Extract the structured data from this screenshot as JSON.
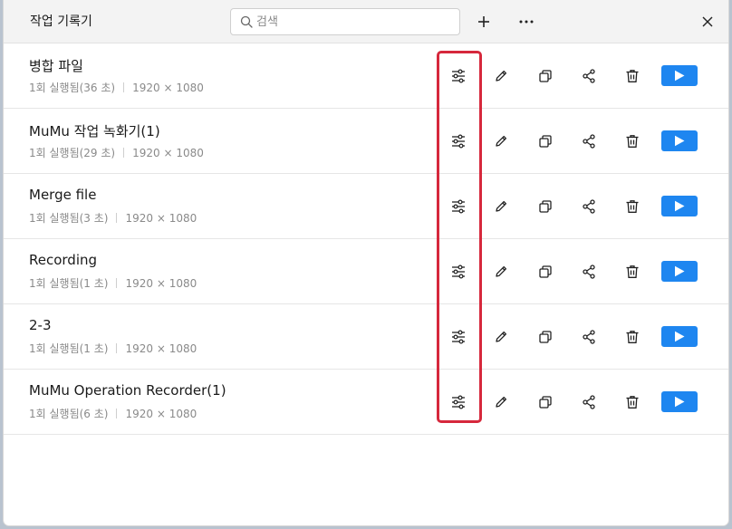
{
  "window": {
    "title": "작업 기록기"
  },
  "search": {
    "placeholder": "검색"
  },
  "toolbar": {
    "add_label": "+",
    "more_label": "···",
    "close_label": "✕"
  },
  "recordings": [
    {
      "name": "병합 파일",
      "runs": "1회 실행됨(36 초)",
      "resolution": "1920 × 1080"
    },
    {
      "name": "MuMu 작업 녹화기(1)",
      "runs": "1회 실행됨(29 초)",
      "resolution": "1920 × 1080"
    },
    {
      "name": "Merge file",
      "runs": "1회 실행됨(3 초)",
      "resolution": "1920 × 1080"
    },
    {
      "name": "Recording",
      "runs": "1회 실행됨(1 초)",
      "resolution": "1920 × 1080"
    },
    {
      "name": "2-3",
      "runs": "1회 실행됨(1 초)",
      "resolution": "1920 × 1080"
    },
    {
      "name": "MuMu Operation Recorder(1)",
      "runs": "1회 실행됨(6 초)",
      "resolution": "1920 × 1080"
    }
  ],
  "icons": [
    "search-icon",
    "plus-icon",
    "more-icon",
    "close-icon",
    "settings-sliders-icon",
    "edit-pencil-icon",
    "copy-icon",
    "share-icon",
    "trash-icon",
    "play-icon"
  ],
  "colors": {
    "accent": "#1e86f0",
    "highlight": "#d6283c"
  }
}
